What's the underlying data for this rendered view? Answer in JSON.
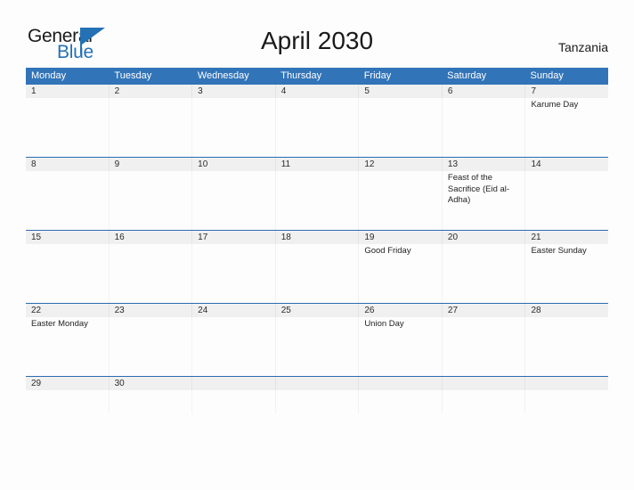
{
  "brand": {
    "name_part1": "General",
    "name_part2": "Blue",
    "flag_icon": "flag-triangle-icon",
    "accent_color": "#2471b5"
  },
  "header": {
    "title": "April 2030",
    "country": "Tanzania"
  },
  "colors": {
    "header_blue": "#3274b8",
    "row_separator_blue": "#2a6db0",
    "daynum_band": "#f0f0f0",
    "page_background": "#fdfdfd"
  },
  "calendar": {
    "month": "April",
    "year": "2030",
    "weekday_headers": [
      "Monday",
      "Tuesday",
      "Wednesday",
      "Thursday",
      "Friday",
      "Saturday",
      "Sunday"
    ],
    "weeks": [
      {
        "size": "tall",
        "days": [
          {
            "num": "1",
            "events": []
          },
          {
            "num": "2",
            "events": []
          },
          {
            "num": "3",
            "events": []
          },
          {
            "num": "4",
            "events": []
          },
          {
            "num": "5",
            "events": []
          },
          {
            "num": "6",
            "events": []
          },
          {
            "num": "7",
            "events": [
              "Karume Day"
            ]
          }
        ]
      },
      {
        "size": "tall",
        "days": [
          {
            "num": "8",
            "events": []
          },
          {
            "num": "9",
            "events": []
          },
          {
            "num": "10",
            "events": []
          },
          {
            "num": "11",
            "events": []
          },
          {
            "num": "12",
            "events": []
          },
          {
            "num": "13",
            "events": [
              "Feast of the Sacrifice (Eid al-Adha)"
            ]
          },
          {
            "num": "14",
            "events": []
          }
        ]
      },
      {
        "size": "tall",
        "days": [
          {
            "num": "15",
            "events": []
          },
          {
            "num": "16",
            "events": []
          },
          {
            "num": "17",
            "events": []
          },
          {
            "num": "18",
            "events": []
          },
          {
            "num": "19",
            "events": [
              "Good Friday"
            ]
          },
          {
            "num": "20",
            "events": []
          },
          {
            "num": "21",
            "events": [
              "Easter Sunday"
            ]
          }
        ]
      },
      {
        "size": "tall",
        "days": [
          {
            "num": "22",
            "events": [
              "Easter Monday"
            ]
          },
          {
            "num": "23",
            "events": []
          },
          {
            "num": "24",
            "events": []
          },
          {
            "num": "25",
            "events": []
          },
          {
            "num": "26",
            "events": [
              "Union Day"
            ]
          },
          {
            "num": "27",
            "events": []
          },
          {
            "num": "28",
            "events": []
          }
        ]
      },
      {
        "size": "short",
        "days": [
          {
            "num": "29",
            "events": []
          },
          {
            "num": "30",
            "events": []
          },
          {
            "num": "",
            "events": []
          },
          {
            "num": "",
            "events": []
          },
          {
            "num": "",
            "events": []
          },
          {
            "num": "",
            "events": []
          },
          {
            "num": "",
            "events": []
          }
        ]
      }
    ]
  }
}
